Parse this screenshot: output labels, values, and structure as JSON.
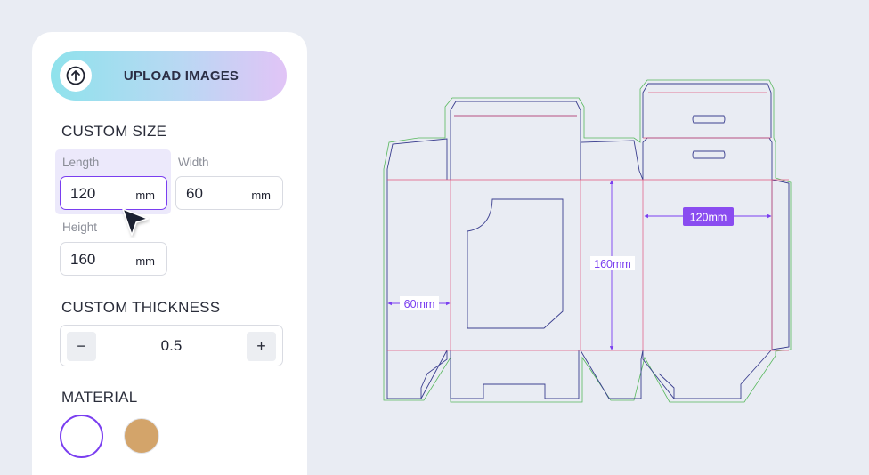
{
  "upload": {
    "label": "UPLOAD IMAGES",
    "icon": "arrow-up-circle-icon"
  },
  "custom_size": {
    "title": "CUSTOM SIZE",
    "length": {
      "label": "Length",
      "value": "120",
      "unit": "mm"
    },
    "width": {
      "label": "Width",
      "value": "60",
      "unit": "mm"
    },
    "height": {
      "label": "Height",
      "value": "160",
      "unit": "mm"
    }
  },
  "custom_thickness": {
    "title": "CUSTOM THICKNESS",
    "value": "0.5",
    "minus": "−",
    "plus": "+"
  },
  "material": {
    "title": "MATERIAL",
    "options": [
      {
        "name": "white",
        "color": "#ffffff",
        "selected": true
      },
      {
        "name": "kraft",
        "color": "#d3a46a",
        "selected": false
      }
    ]
  },
  "dieline": {
    "dim_width": "60mm",
    "dim_height": "160mm",
    "dim_length": "120mm"
  },
  "colors": {
    "accent": "#7a3ef0",
    "cut_line": "#3b3f8f",
    "fold_line": "#e2557d",
    "bleed_line": "#58b85d",
    "label_bg": "#8a4cf0"
  }
}
